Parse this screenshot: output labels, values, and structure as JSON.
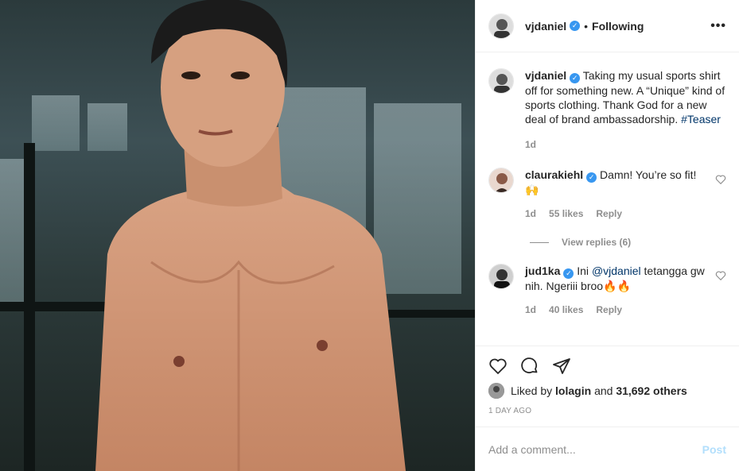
{
  "post": {
    "author": "vjdaniel",
    "follow_status": "Following",
    "more_label": "•••",
    "caption_text": " Taking my usual sports shirt off for something new. A “Unique” kind of sports clothing. Thank God for a new deal of brand ambassadorship.",
    "hashtag": "#Teaser",
    "caption_age": "1d"
  },
  "comments": [
    {
      "username": "claurakiehl",
      "text": " Damn! You’re so fit!",
      "emoji": "🙌",
      "age": "1d",
      "likes": "55 likes",
      "reply_label": "Reply",
      "view_replies": "View replies (6)"
    },
    {
      "username": "jud1ka",
      "text_before": " Ini ",
      "mention": "@vjdaniel",
      "text_after": " tetangga gw nih. Ngeriii broo",
      "emoji": "🔥🔥",
      "age": "1d",
      "likes": "40 likes",
      "reply_label": "Reply"
    }
  ],
  "likes_bar": {
    "prefix": "Liked by ",
    "user": "lolagin",
    "middle": " and ",
    "count": "31,692 others"
  },
  "timestamp": "1 DAY AGO",
  "add_comment": {
    "placeholder": "Add a comment...",
    "post_label": "Post"
  },
  "colors": {
    "verified": "#3897f0",
    "link": "#003569",
    "post_disabled": "#b2dffc"
  },
  "icons": [
    "heart-icon",
    "comment-icon",
    "share-icon",
    "verified-badge-icon",
    "more-icon"
  ]
}
